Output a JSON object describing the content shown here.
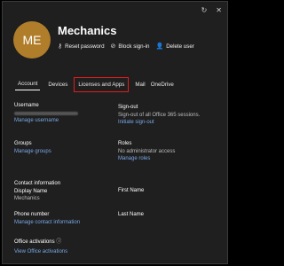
{
  "user": {
    "initials": "ME",
    "name": "Mechanics"
  },
  "window_icons": [
    "refresh-icon",
    "close-icon"
  ],
  "actions": [
    {
      "icon": "key-icon",
      "label": "Reset password"
    },
    {
      "icon": "block-icon",
      "label": "Block sign-in"
    },
    {
      "icon": "person-remove-icon",
      "label": "Delete user"
    }
  ],
  "tabs": [
    "Account",
    "Devices",
    "Licenses and Apps",
    "Mail",
    "OneDrive"
  ],
  "account": {
    "username_label": "Username",
    "manage_username": "Manage username",
    "signout_label": "Sign-out",
    "signout_desc": "Sign-out of all Office 365 sessions.",
    "signout_link": "Initiate sign-out",
    "groups_label": "Groups",
    "manage_groups": "Manage groups",
    "roles_label": "Roles",
    "roles_value": "No administrator access",
    "manage_roles": "Manage roles",
    "contact_label": "Contact information",
    "display_name_label": "Display Name",
    "display_name_value": "Mechanics",
    "first_name_label": "First Name",
    "phone_label": "Phone number",
    "manage_contact": "Manage contact information",
    "last_name_label": "Last Name",
    "office_activations_label": "Office activations",
    "view_office_activations": "View Office activations"
  },
  "colors": {
    "accent_link": "#7aa8e6",
    "avatar_bg": "#b07d2a",
    "highlight": "#e01e1e",
    "panel_bg": "#1f1f1f"
  }
}
